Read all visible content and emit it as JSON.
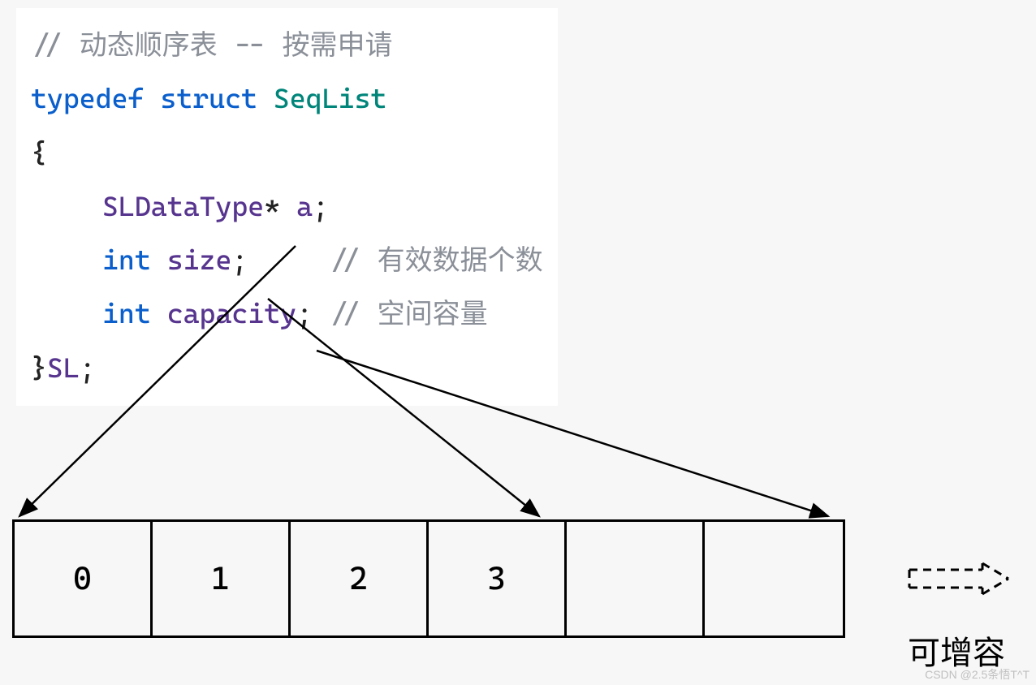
{
  "code": {
    "line1_comment": "// 动态顺序表 -- 按需申请",
    "line2_typedef": "typedef",
    "line2_struct": "struct",
    "line2_name": "SeqList",
    "line3_brace": "{",
    "line4_type": "SLDataType",
    "line4_ptr": "*",
    "line4_var": " a",
    "line4_semi": ";",
    "line5_int": "int",
    "line5_var": " size",
    "line5_semi": ";",
    "line5_comment": "// 有效数据个数",
    "line6_int": "int",
    "line6_var": " capacity",
    "line6_semi": ";",
    "line6_comment": "// 空间容量",
    "line7_close": "}",
    "line7_alias": "SL",
    "line7_semi": ";"
  },
  "array": {
    "cells": [
      "0",
      "1",
      "2",
      "3",
      "",
      ""
    ]
  },
  "expand_label": "可增容",
  "watermark": "CSDN @2.5条悟T^T"
}
